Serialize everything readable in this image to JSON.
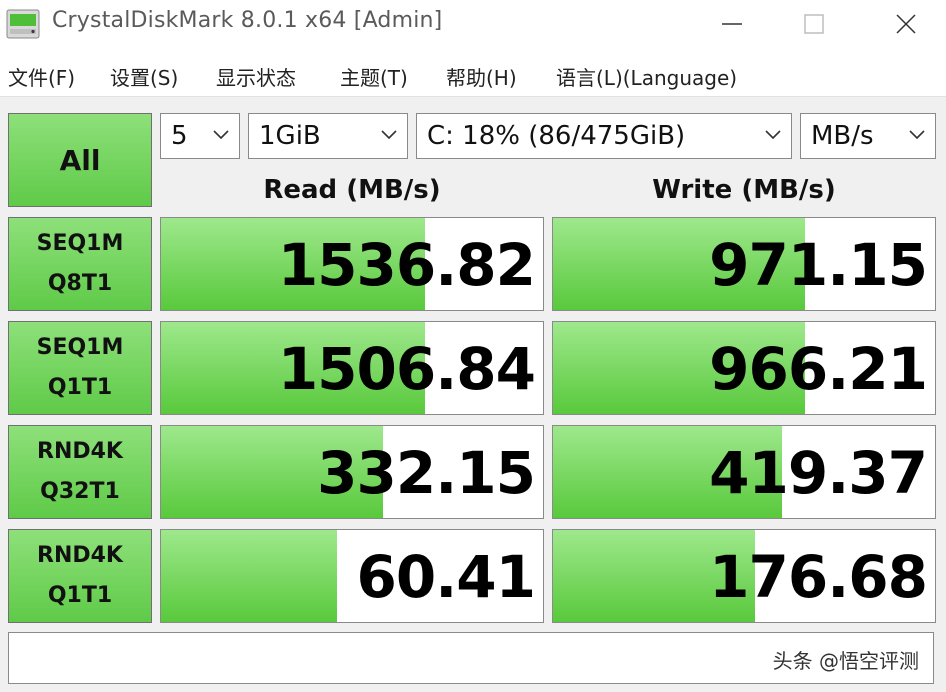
{
  "window": {
    "title": "CrystalDiskMark 8.0.1 x64 [Admin]",
    "controls": [
      "minimize",
      "maximize",
      "close"
    ]
  },
  "menu": [
    "文件(F)",
    "设置(S)",
    "显示状态",
    "主题(T)",
    "帮助(H)",
    "语言(L)(Language)"
  ],
  "all_button": "All",
  "selects": {
    "count": "5",
    "size": "1GiB",
    "drive": "C: 18% (86/475GiB)",
    "unit": "MB/s"
  },
  "headers": {
    "read": "Read (MB/s)",
    "write": "Write (MB/s)"
  },
  "tests": [
    {
      "line1": "SEQ1M",
      "line2": "Q8T1",
      "read": "1536.82",
      "write": "971.15",
      "read_fill": 0.69,
      "write_fill": 0.66
    },
    {
      "line1": "SEQ1M",
      "line2": "Q1T1",
      "read": "1506.84",
      "write": "966.21",
      "read_fill": 0.69,
      "write_fill": 0.66
    },
    {
      "line1": "RND4K",
      "line2": "Q32T1",
      "read": "332.15",
      "write": "419.37",
      "read_fill": 0.58,
      "write_fill": 0.6
    },
    {
      "line1": "RND4K",
      "line2": "Q1T1",
      "read": "60.41",
      "write": "176.68",
      "read_fill": 0.46,
      "write_fill": 0.53
    }
  ],
  "status_text": "",
  "watermark": "头条 @悟空评测",
  "colors": {
    "accent_green": "#59c93c",
    "button_green": "#6fd35a"
  }
}
